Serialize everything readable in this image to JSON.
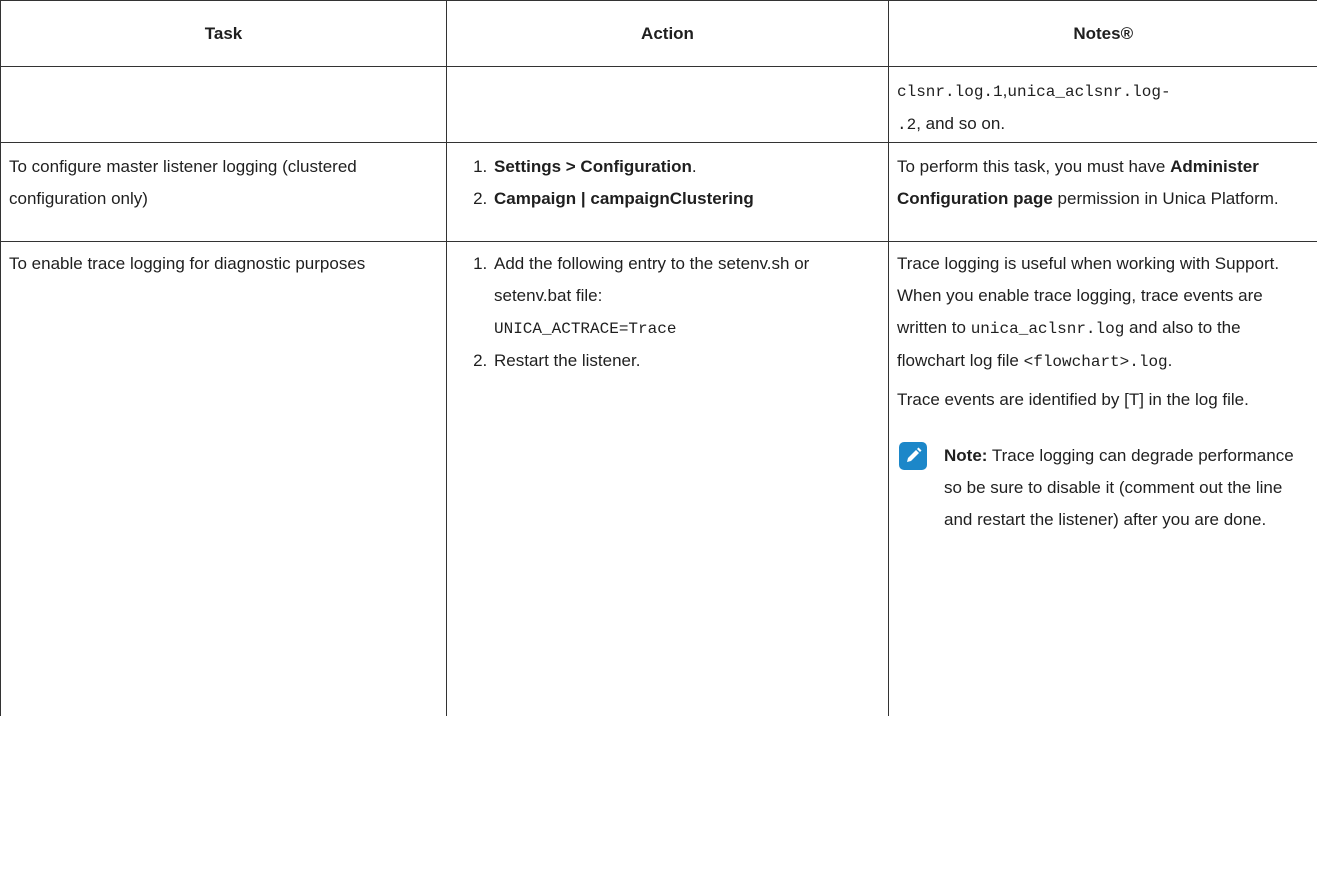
{
  "table": {
    "headers": [
      "Task",
      "Action",
      "Notes®"
    ],
    "row1": {
      "notes_l1_code": "clsnr.log.1",
      "notes_l1_sep": ",",
      "notes_l1_code2": "unica_aclsnr.log-",
      "notes_l2_code": ".2",
      "notes_l2_text": ", and so on."
    },
    "row2": {
      "task": "To configure master listener logging (clustered configuration only)",
      "step1_bold": "Settings >  Configuration",
      "step1_tail": ".",
      "step2_bold": "Campaign | campaignCluster­ing",
      "notes_pre": "To perform this task, you must have ",
      "notes_bold": "Administer Configuration page",
      "notes_post": " permis­sion in  Unica Platform."
    },
    "row3": {
      "task": "To enable trace logging for diagnostic purposes",
      "step1_text": "Add the following entry to the setenv.sh or setenv.bat file:",
      "step1_code": "UNICA_ACTRACE=Trace",
      "step2_text": "Restart the listener.",
      "p1_a": "Trace logging is useful when working with Support. When you enable trace logging, trace events are written to ",
      "p1_code1": "unica_aclsnr.log",
      "p1_b": " and also to the flowchart log file ",
      "p1_code2": "<flowchart>.log",
      "p1_c": ".",
      "p2": "Trace events are identified by [T] in the log file.",
      "note_label": "Note:",
      "note_text": " Trace logging can de­grade performance so be sure to disable it (comment out the line and restart the listener) af­ter you are done."
    }
  },
  "icons": {
    "note": "pencil-note-icon"
  },
  "colors": {
    "note_icon_bg": "#1c87c9"
  }
}
